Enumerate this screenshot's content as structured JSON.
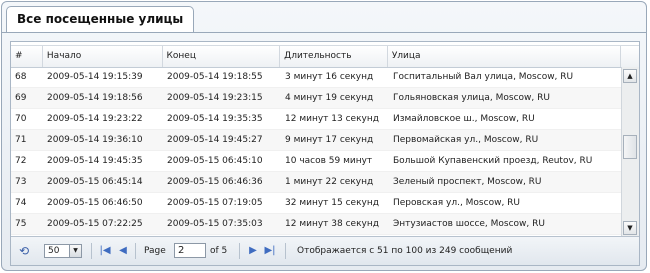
{
  "tab": {
    "label": "Все посещенные улицы"
  },
  "grid": {
    "columns": [
      "#",
      "Начало",
      "Конец",
      "Длительность",
      "Улица"
    ],
    "rows": [
      [
        "68",
        "2009-05-14 19:15:39",
        "2009-05-14 19:18:55",
        "3 минут 16 секунд",
        "Госпитальный Вал улица, Moscow, RU"
      ],
      [
        "69",
        "2009-05-14 19:18:56",
        "2009-05-14 19:23:15",
        "4 минут 19 секунд",
        "Гольяновская улица, Moscow, RU"
      ],
      [
        "70",
        "2009-05-14 19:23:22",
        "2009-05-14 19:35:35",
        "12 минут 13 секунд",
        "Измайловское ш., Moscow, RU"
      ],
      [
        "71",
        "2009-05-14 19:36:10",
        "2009-05-14 19:45:27",
        "9 минут 17 секунд",
        "Первомайская ул., Moscow, RU"
      ],
      [
        "72",
        "2009-05-14 19:45:35",
        "2009-05-15 06:45:10",
        "10 часов 59 минут",
        "Большой Купавенский проезд, Reutov, RU"
      ],
      [
        "73",
        "2009-05-15 06:45:14",
        "2009-05-15 06:46:36",
        "1 минут 22 секунд",
        "Зеленый проспект, Moscow, RU"
      ],
      [
        "74",
        "2009-05-15 06:46:50",
        "2009-05-15 07:19:05",
        "32 минут 15 секунд",
        "Перовская ул., Moscow, RU"
      ],
      [
        "75",
        "2009-05-15 07:22:25",
        "2009-05-15 07:35:03",
        "12 минут 38 секунд",
        "Энтузиастов шоссе, Moscow, RU"
      ],
      [
        "76",
        "2009-05-15 07:35:08",
        "2009-05-15 07:37:27",
        "2 минут 19 секунд",
        "ул. Сергия Радонежского, Moscow, RU"
      ]
    ]
  },
  "scrollbar": {
    "up_icon": "triangle-up",
    "down_icon": "triangle-down"
  },
  "pager": {
    "page_size": "50",
    "page_label": "Page",
    "page_value": "2",
    "of_label": "of 5",
    "display_message": "Отображается с 51 по 100 из 249 сообщений",
    "icons": {
      "refresh": "refresh-icon",
      "first": "first-page-icon",
      "prev": "prev-page-icon",
      "next": "next-page-icon",
      "last": "last-page-icon"
    }
  }
}
